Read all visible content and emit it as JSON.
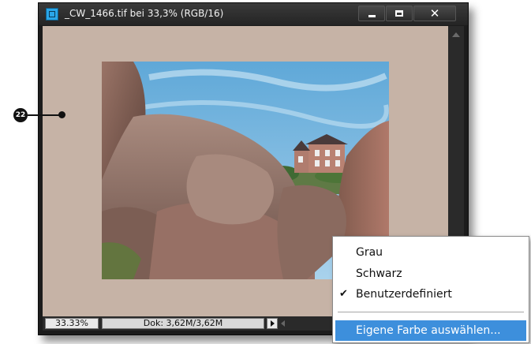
{
  "window": {
    "title": "_CW_1466.tif bei 33,3% (RGB/16)",
    "minimize_glyph": "",
    "close_glyph": "✕"
  },
  "status_bar": {
    "zoom": "33.33%",
    "doc_info": "Dok: 3,62M/3,62M"
  },
  "callout": {
    "number": "22"
  },
  "context_menu": {
    "items": [
      {
        "label": "Grau",
        "checked": false
      },
      {
        "label": "Schwarz",
        "checked": false
      },
      {
        "label": "Benutzerdefiniert",
        "checked": true
      },
      {
        "label": "Eigene Farbe auswählen...",
        "checked": false,
        "highlighted": true
      }
    ],
    "check_glyph": "✔"
  },
  "colors": {
    "pasteboard": "#c6b3a6",
    "highlight": "#3d8fdc",
    "window_frame": "#1c1c1c"
  },
  "icons": {
    "app": "photoshop-elements-icon",
    "callout_marker": "callout-dot-icon"
  }
}
